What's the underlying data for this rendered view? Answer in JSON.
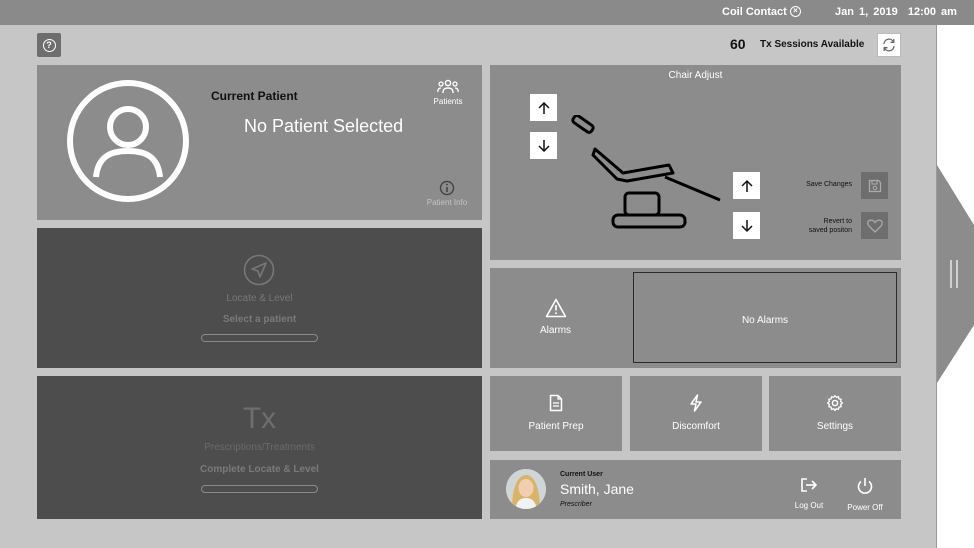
{
  "topbar": {
    "coil_status": "Coil Contact",
    "coil_icon": "close-circle-icon",
    "date": "Jan 1, 2019",
    "time": "12:00 am"
  },
  "header": {
    "help_icon": "help-icon",
    "sessions_count": "60",
    "sessions_label": "Tx Sessions Available",
    "refresh_icon": "refresh-icon"
  },
  "patient": {
    "label": "Current Patient",
    "value": "No Patient Selected",
    "patients_label": "Patients",
    "info_label": "Patient Info"
  },
  "locate": {
    "label": "Locate & Level",
    "sub": "Select a patient"
  },
  "tx": {
    "icon_text": "Tx",
    "label": "Prescriptions/Treatments",
    "sub": "Complete Locate & Level"
  },
  "chair": {
    "title": "Chair Adjust",
    "save_label": "Save Changes",
    "revert_label_line1": "Revert to",
    "revert_label_line2": "saved positon"
  },
  "alarms": {
    "label": "Alarms",
    "status": "No Alarms"
  },
  "tiles": {
    "prep": "Patient Prep",
    "discomfort": "Discomfort",
    "settings": "Settings"
  },
  "user": {
    "current_label": "Current User",
    "name": "Smith, Jane",
    "role": "Prescriber",
    "logout_label": "Log Out",
    "power_label": "Power Off"
  },
  "colors": {
    "topbar": "#8a8a8a",
    "frame": "#c6c6c6",
    "panel": "#8c8c8c",
    "panel_disabled": "#4d4d4d"
  }
}
